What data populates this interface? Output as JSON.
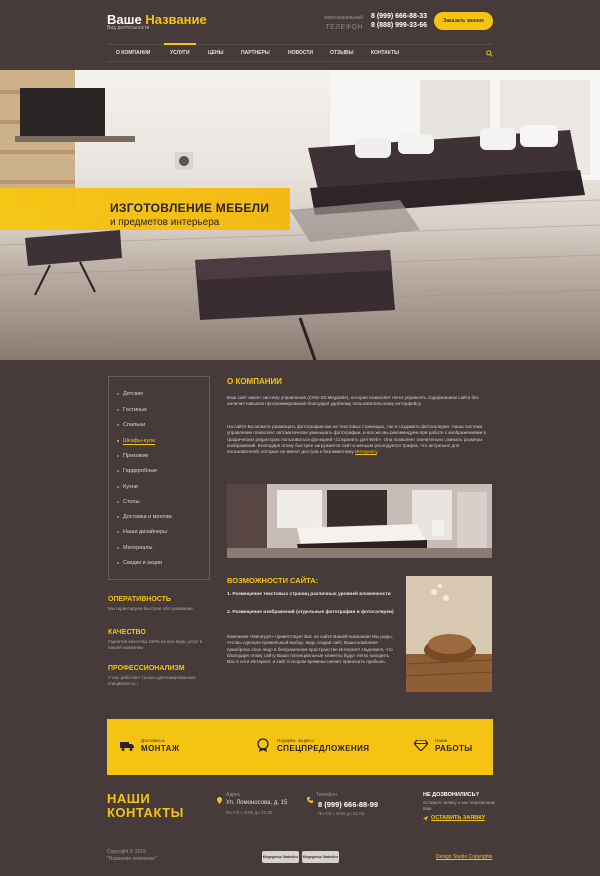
{
  "header": {
    "brand_word1": "Ваше",
    "brand_word2": "Название",
    "brand_sub": "Вид деятельности",
    "phone_caption_line1": "многоканальный",
    "phone_caption_line2": "ТЕЛЕФОН",
    "phone1": "8 (999) 666-88-33",
    "phone2": "8 (888) 999-33-66",
    "cta_label": "Заказать звонок"
  },
  "nav": {
    "items": [
      "О КОМПАНИИ",
      "УСЛУГИ",
      "ЦЕНЫ",
      "ПАРТНЕРЫ",
      "НОВОСТИ",
      "ОТЗЫВЫ",
      "КОНТАКТЫ"
    ],
    "active_index": 1,
    "search_icon": "search-icon"
  },
  "hero": {
    "title": "ИЗГОТОВЛЕНИЕ МЕБЕЛИ",
    "subtitle": "и предметов интерьера"
  },
  "sidebar": {
    "items": [
      "Детские",
      "Гостиные",
      "Спальни",
      "Шкафы-купе",
      "Прихожие",
      "Гардеробные",
      "Кухни",
      "Столы",
      "Доставка и монтаж",
      "Наши дизайнеры",
      "Материалы",
      "Скидки и акции"
    ],
    "active_index": 3
  },
  "features_side": [
    {
      "title": "ОПЕРАТИВНОСТЬ",
      "text": "Мы гарантируем быстрое обслуживание"
    },
    {
      "title": "КАЧЕСТВО",
      "text": "Гарантия качества 100% на все виды услуг в нашей компании"
    },
    {
      "title": "ПРОФЕССИОНАЛИЗМ",
      "text": "У нас работают только дипломированные специалисты !"
    }
  ],
  "about": {
    "title": "О КОМПАНИИ",
    "p1": "Ваш сайт имеет систему управления (CMS-S3 MegaSite), которая позволяет легко управлять содержанием сайта без наличия навыков программирования благодаря удобному пользовательскому интерфейсу.",
    "p2": "На сайте Вы можете размещать фотографии как на текстовых страницах, так и создавать фотогалереи. Наша система управления позволяет автоматически уменьшать фотографии, и все же мы рекомендуем при работе с изображениями в графических редакторах пользоваться функцией «Сохранить для Web». Она позволяет значительно сжимать размеры изображений. Благодаря этому быстрее загружается сайт и меньше расходуется трафик, что актуально для пользователей, которые не имеют доступа к безлимитному",
    "p2_link": "Интернету"
  },
  "capabilities": {
    "title": "ВОЗМОЖНОСТИ САЙТА:",
    "item1": "1. Размещение текстовых страниц различных уровней вложенности",
    "item2": "2. Размещение изображений (отдельные фотографии и фотогалереи)",
    "text": "Компания «Мегагруп» приветствует Вас на сайте Вашей компании! Мы рады, что Вы сделали правильный выбор, ведь создав сайт, Ваша компания приобрела свое лицо в безграничном пространстве Интернет! Надеемся, что благодаря этому сайту Ваши потенциальные клиенты будут легко находить Вас в сети Интернет, и сайт в скором времени начнет приносить прибыль."
  },
  "promo": [
    {
      "small": "Доставка и",
      "big": "МОНТАЖ",
      "icon": "truck-icon"
    },
    {
      "small": "Подарки, акции и",
      "big": "СПЕЦПРЕДЛОЖЕНИЯ",
      "icon": "badge-icon"
    },
    {
      "small": "Наши",
      "big": "РАБОТЫ",
      "icon": "diamond-icon"
    }
  ],
  "footer": {
    "title_line1": "НАШИ",
    "title_line2": "КОНТАКТЫ",
    "address_label": "Адрес",
    "address": "Ул. Ломоносова, д. 15",
    "address_hours": "Пн-Сб с 9:00 до 21:00",
    "phone_label": "Телефон",
    "phone": "8 (999) 666-88-99",
    "phone_hours": "Пн-Сб с 9:00 до 21:00",
    "call_title": "НЕ ДОЗВОНИЛИСЬ?",
    "call_text": "оставьте заявку и мы перезвоним вам",
    "call_link": "ОСТАВИТЬ ЗАЯВКУ",
    "copyright_line1": "Copyright © 2015",
    "copyright_line2": "\"Название компании\"",
    "badge1": "Megagroup Statistics",
    "badge2": "Megagroup Statistics",
    "design_link": "Design Studio Copyrights"
  },
  "colors": {
    "background": "#463a3b",
    "accent": "#f5c412",
    "text_light": "#e6dcdc"
  }
}
